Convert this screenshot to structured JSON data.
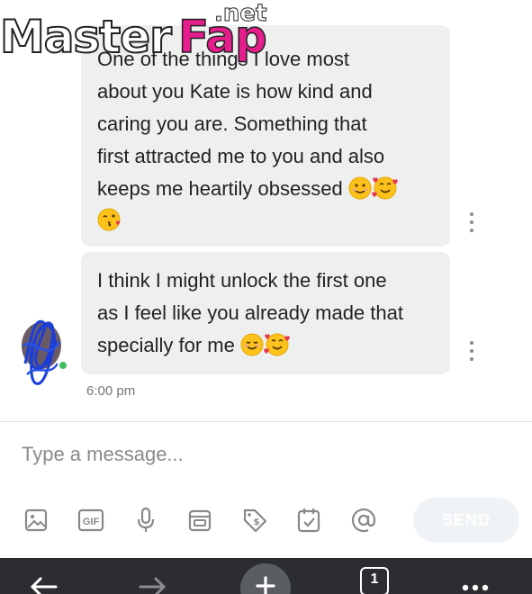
{
  "watermark": {
    "master": "Master",
    "fap": "Fap",
    "net": ".net"
  },
  "messages": [
    {
      "text": "One of the things I love most\nabout you Kate is how kind and\ncaring you are. Something that\nfirst attracted me to you and also\nkeeps me heartily obsessed ",
      "emojis": [
        "smiling-face-emoji",
        "smiling-face-with-hearts-emoji",
        "face-blowing-kiss-emoji"
      ]
    },
    {
      "text": "I think I might unlock the first one\nas I feel like you already made that\nspecially for me ",
      "emojis": [
        "smiling-face-emoji",
        "smiling-face-with-hearts-emoji"
      ]
    }
  ],
  "timestamp": "6:00 pm",
  "composer": {
    "placeholder": "Type a message...",
    "send_label": "SEND",
    "tools": [
      "image-icon",
      "gif-icon",
      "microphone-icon",
      "sticker-icon",
      "price-tag-icon",
      "calendar-icon",
      "at-sign-icon"
    ],
    "gif_label": "GIF"
  },
  "browser_bar": {
    "tab_count": "1"
  },
  "colors": {
    "bubble": "#eef0f0",
    "accent": "#1da1f2",
    "nav": "#2b2d30",
    "online": "#3fbf5f"
  }
}
